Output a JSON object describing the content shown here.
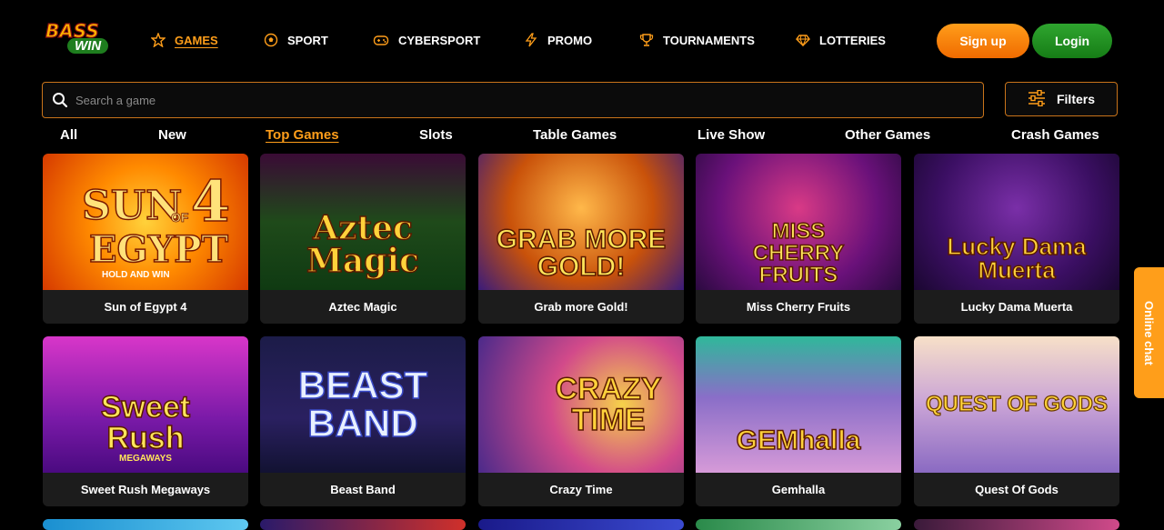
{
  "brand": {
    "line1": "BASS",
    "line2": "WIN"
  },
  "nav": [
    {
      "label": "GAMES",
      "icon": "star-icon",
      "active": true
    },
    {
      "label": "SPORT",
      "icon": "soccer-ball-icon",
      "active": false
    },
    {
      "label": "CYBERSPORT",
      "icon": "gamepad-icon",
      "active": false
    },
    {
      "label": "PROMO",
      "icon": "lightning-icon",
      "active": false
    },
    {
      "label": "TOURNAMENTS",
      "icon": "trophy-icon",
      "active": false
    },
    {
      "label": "LOTTERIES",
      "icon": "diamond-icon",
      "active": false
    }
  ],
  "auth": {
    "signup": "Sign up",
    "login": "Login"
  },
  "search": {
    "placeholder": "Search a game"
  },
  "filters": {
    "label": "Filters"
  },
  "tabs": [
    {
      "label": "All",
      "active": false
    },
    {
      "label": "New",
      "active": false
    },
    {
      "label": "Top Games",
      "active": true
    },
    {
      "label": "Slots",
      "active": false
    },
    {
      "label": "Table Games",
      "active": false
    },
    {
      "label": "Live Show",
      "active": false
    },
    {
      "label": "Other Games",
      "active": false
    },
    {
      "label": "Crash Games",
      "active": false
    }
  ],
  "games": [
    {
      "name": "Sun of Egypt 4",
      "art": "SUN 4\nEGYPT"
    },
    {
      "name": "Aztec Magic",
      "art": "Aztec\nMagic"
    },
    {
      "name": "Grab more Gold!",
      "art": "GRAB MORE\nGOLD!"
    },
    {
      "name": "Miss Cherry Fruits",
      "art": "MISS\nCHERRY\nFRUITS"
    },
    {
      "name": "Lucky Dama Muerta",
      "art": "Lucky Dama\nMuerta"
    },
    {
      "name": "Sweet Rush Megaways",
      "art": "Sweet\nRush"
    },
    {
      "name": "Beast Band",
      "art": "BEAST\nBAND"
    },
    {
      "name": "Crazy Time",
      "art": "CRAZY\nTIME"
    },
    {
      "name": "Gemhalla",
      "art": "GEMhalla"
    },
    {
      "name": "Quest Of Gods",
      "art": "QUEST OF GODS"
    }
  ],
  "sun_art": {
    "main": "SUN",
    "of": "OF",
    "four": "4",
    "egypt": "EGYPT",
    "sub": "HOLD AND WIN"
  },
  "sweet_art": {
    "sub": "MEGAWAYS"
  },
  "chat": {
    "label": "Online chat"
  }
}
